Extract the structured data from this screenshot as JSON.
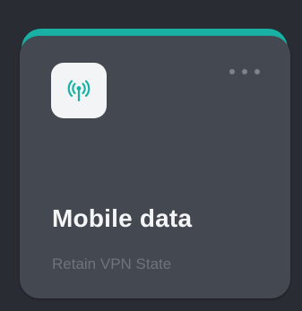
{
  "tile": {
    "title": "Mobile data",
    "subtitle": "Retain VPN State",
    "icon": "cell-tower-icon",
    "menu_icon": "more-horizontal-icon"
  },
  "colors": {
    "background": "#292c32",
    "card": "#444851",
    "accent": "#19b1a4",
    "icon_tile": "#f2f4f5",
    "title": "#f4f5f6",
    "subtitle": "#6f737c",
    "menu_dots": "#7d828b"
  }
}
